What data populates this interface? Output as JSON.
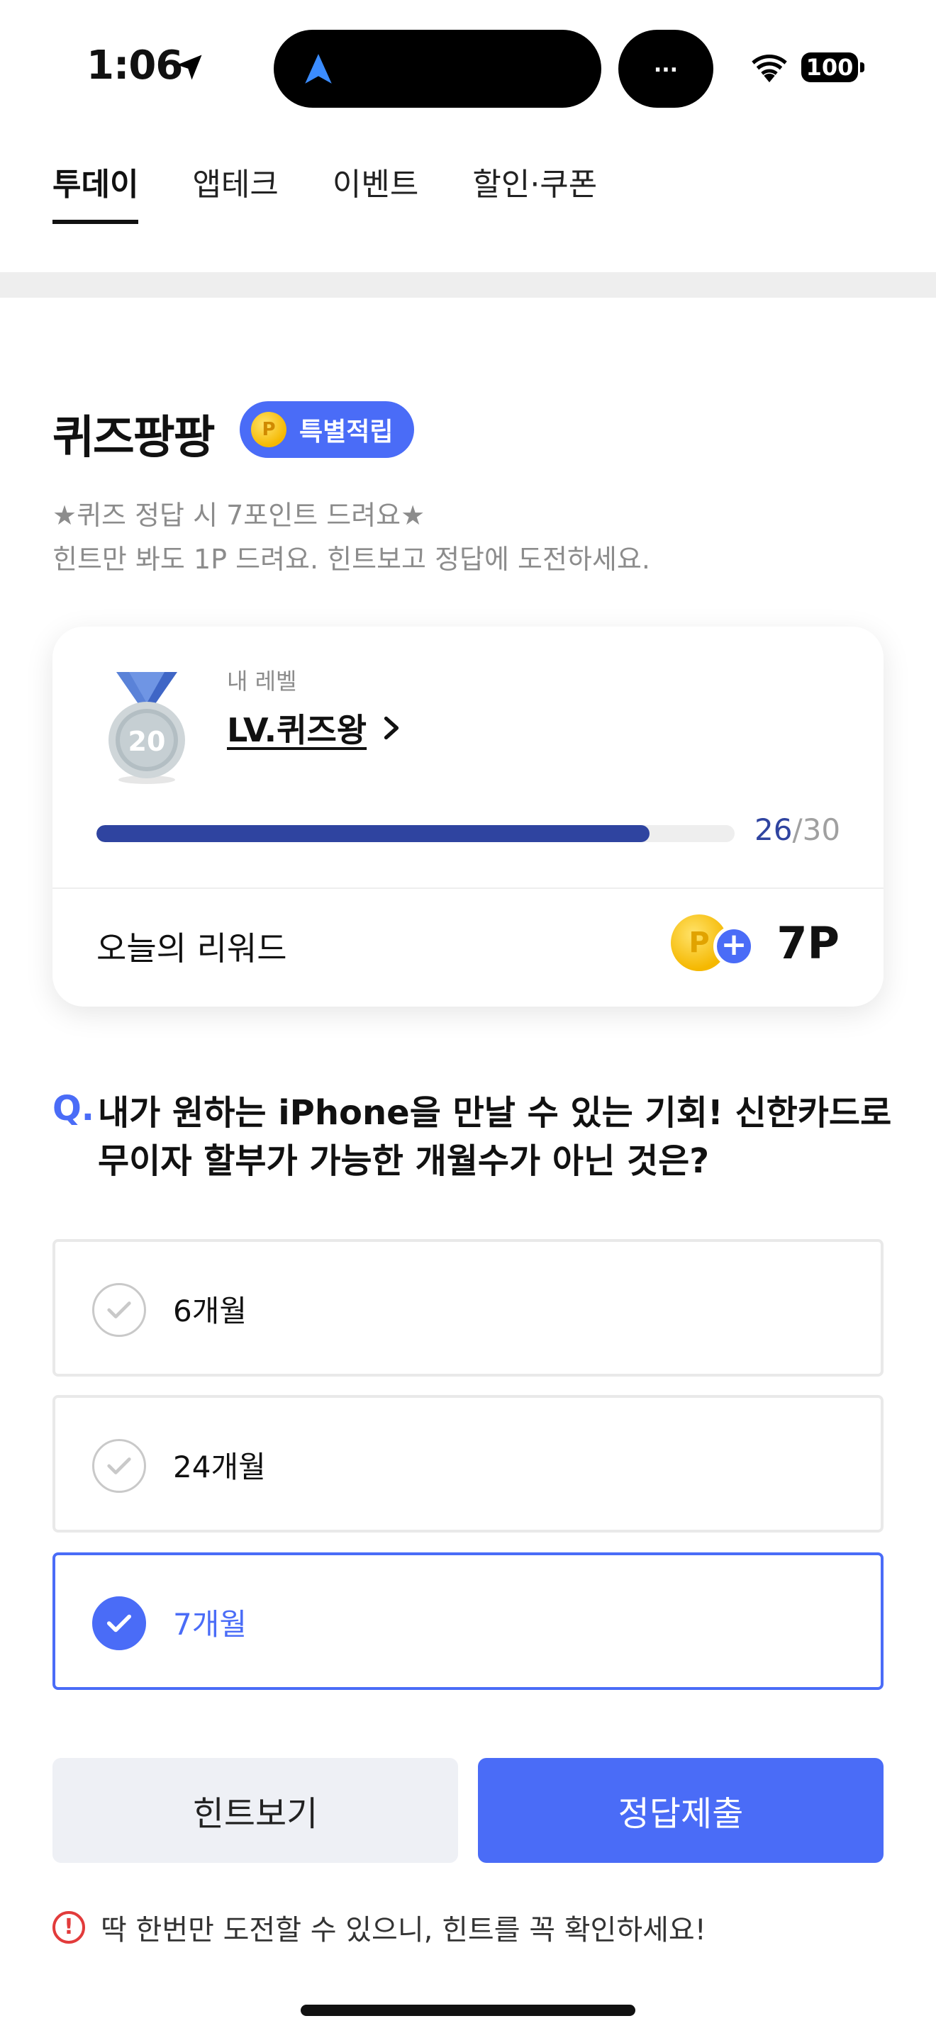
{
  "status_bar": {
    "time": "1:06",
    "activity_label": "...",
    "battery": "100"
  },
  "tabs": [
    {
      "label": "투데이",
      "active": true
    },
    {
      "label": "앱테크",
      "active": false
    },
    {
      "label": "이벤트",
      "active": false
    },
    {
      "label": "할인·쿠폰",
      "active": false
    }
  ],
  "quiz": {
    "title": "퀴즈팡팡",
    "badge_coin": "P",
    "badge_label": "특별적립",
    "desc_line1": "★퀴즈 정답 시 7포인트 드려요★",
    "desc_line2": "힌트만 봐도 1P 드려요. 힌트보고 정답에 도전하세요."
  },
  "level_card": {
    "medal_number": "20",
    "caption": "내 레벨",
    "level_name": "LV.퀴즈왕",
    "progress_current": "26",
    "progress_separator": "/",
    "progress_total": "30",
    "progress_fraction": 0.867,
    "reward_label": "오늘의 리워드",
    "reward_coin": "P",
    "reward_value": "7P"
  },
  "question": {
    "mark": "Q.",
    "text": "내가 원하는 iPhone을 만날 수 있는 기회! 신한카드로 무이자 할부가 가능한 개월수가 아닌 것은?"
  },
  "options": [
    {
      "label": "6개월",
      "selected": false
    },
    {
      "label": "24개월",
      "selected": false
    },
    {
      "label": "7개월",
      "selected": true
    }
  ],
  "buttons": {
    "hint": "힌트보기",
    "submit": "정답제출"
  },
  "notice": {
    "icon": "!",
    "text": "딱 한번만 도전할 수 있으니, 힌트를 꼭 확인하세요!"
  },
  "colors": {
    "accent": "#4a6cf7",
    "progress": "#2f44a0",
    "warning": "#e23b3b"
  }
}
